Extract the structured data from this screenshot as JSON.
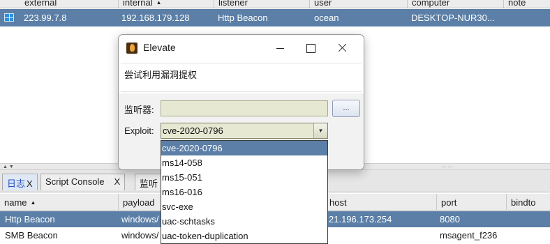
{
  "sessions_table": {
    "columns": [
      "external",
      "internal",
      "listener",
      "user",
      "computer",
      "note"
    ],
    "sorted_column": "internal",
    "rows": [
      {
        "external": "223.99.7.8",
        "internal": "192.168.179.128",
        "listener": "Http Beacon",
        "user": "ocean",
        "computer": "DESKTOP-NUR30...",
        "note": ""
      }
    ]
  },
  "tabs": [
    {
      "label": "日志",
      "close": "X"
    },
    {
      "label": "Script Console",
      "close": "X"
    },
    {
      "label": "监听",
      "close": ""
    }
  ],
  "listeners_table": {
    "columns": [
      "name",
      "payload",
      "host",
      "port",
      "bindto"
    ],
    "sorted_column": "name",
    "rows": [
      {
        "name": "Http Beacon",
        "payload": "windows/",
        "host": "21.196.173.254",
        "port": "8080",
        "bindto": ""
      },
      {
        "name": "SMB Beacon",
        "payload": "windows/",
        "host": "",
        "port": "msagent_f236",
        "bindto": ""
      }
    ]
  },
  "dialog": {
    "title": "Elevate",
    "description": "尝试利用漏洞提权",
    "listener_label": "监听器:",
    "listener_value": "",
    "browse_label": "...",
    "exploit_label": "Exploit:",
    "exploit_value": "cve-2020-0796",
    "exploit_options": [
      "cve-2020-0796",
      "ms14-058",
      "ms15-051",
      "ms16-016",
      "svc-exe",
      "uac-schtasks",
      "uac-token-duplication"
    ]
  },
  "colors": {
    "selection": "#5b7fa6",
    "input_background": "#e6e8d2",
    "active_tab_text": "#1f4cc4"
  }
}
